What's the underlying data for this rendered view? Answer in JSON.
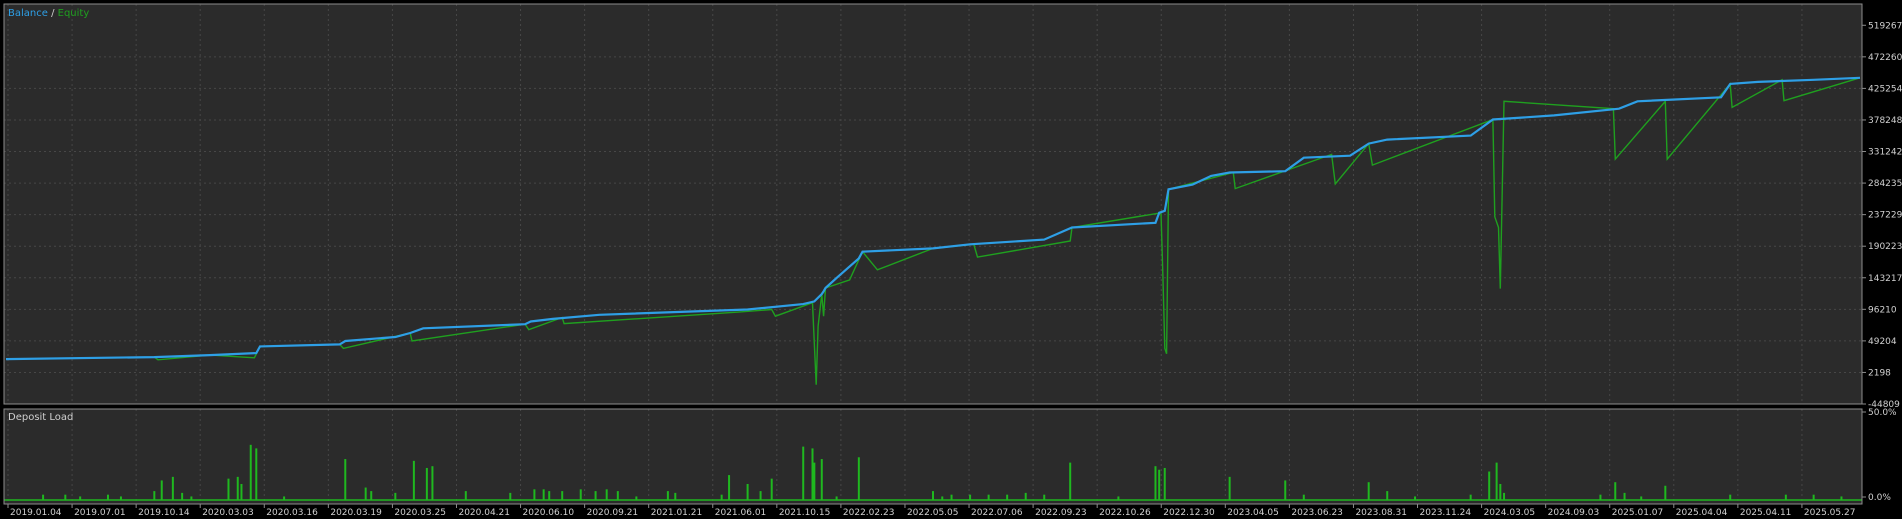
{
  "colors": {
    "background": "#000000",
    "plot_bg": "#2b2b2b",
    "frame": "#8c8c8c",
    "grid": "#474747",
    "balance": "#2e9fe6",
    "equity": "#1fa01f",
    "deposit_load": "#1fb81f",
    "axis_text": "#d0d0d0"
  },
  "main_panel": {
    "legend": {
      "balance": "Balance",
      "separator": " / ",
      "equity": "Equity"
    }
  },
  "sub_panel": {
    "title": "Deposit Load"
  },
  "chart_data": [
    {
      "type": "line",
      "title": "",
      "legend_location": "top-left",
      "grid": true,
      "ylim": [
        -44809,
        545000
      ],
      "y_ticks": [
        519267,
        472260,
        425254,
        378248,
        331242,
        284235,
        237229,
        190223,
        143217,
        96210,
        49204,
        2198,
        -44809
      ],
      "x_tick_labels": [
        "2019.01.04",
        "2019.07.01",
        "2019.10.14",
        "2020.03.03",
        "2020.03.16",
        "2020.03.19",
        "2020.03.25",
        "2020.04.21",
        "2020.06.10",
        "2020.09.21",
        "2021.01.21",
        "2021.06.01",
        "2021.10.15",
        "2022.02.23",
        "2022.05.05",
        "2022.07.06",
        "2022.09.23",
        "2022.10.26",
        "2022.12.30",
        "2023.04.05",
        "2023.06.23",
        "2023.08.31",
        "2023.11.24",
        "2024.03.05",
        "2024.09.03",
        "2025.01.07",
        "2025.04.04",
        "2025.04.11",
        "2025.05.27"
      ],
      "x_domain": [
        0,
        1000
      ],
      "series": [
        {
          "name": "Balance",
          "points": [
            [
              0,
              22000
            ],
            [
              80,
              25000
            ],
            [
              110,
              28000
            ],
            [
              135,
              31000
            ],
            [
              137,
              41000
            ],
            [
              180,
              44000
            ],
            [
              183,
              49000
            ],
            [
              210,
              55000
            ],
            [
              218,
              61000
            ],
            [
              225,
              68000
            ],
            [
              280,
              74000
            ],
            [
              283,
              78000
            ],
            [
              295,
              82000
            ],
            [
              320,
              88000
            ],
            [
              400,
              96000
            ],
            [
              430,
              104000
            ],
            [
              436,
              108000
            ],
            [
              440,
              119000
            ],
            [
              441,
              123000
            ],
            [
              442,
              128000
            ],
            [
              448,
              143000
            ],
            [
              460,
              172000
            ],
            [
              462,
              182000
            ],
            [
              500,
              187000
            ],
            [
              520,
              193000
            ],
            [
              560,
              200000
            ],
            [
              575,
              218000
            ],
            [
              620,
              225000
            ],
            [
              622,
              240000
            ],
            [
              625,
              243000
            ],
            [
              627,
              275000
            ],
            [
              640,
              282000
            ],
            [
              650,
              295000
            ],
            [
              660,
              300000
            ],
            [
              690,
              302000
            ],
            [
              700,
              322000
            ],
            [
              725,
              325000
            ],
            [
              735,
              343000
            ],
            [
              745,
              349000
            ],
            [
              790,
              355000
            ],
            [
              802,
              379000
            ],
            [
              835,
              385000
            ],
            [
              870,
              395000
            ],
            [
              880,
              406000
            ],
            [
              925,
              412000
            ],
            [
              930,
              432000
            ],
            [
              945,
              435000
            ],
            [
              975,
              438000
            ],
            [
              1000,
              441000
            ]
          ]
        },
        {
          "name": "Equity",
          "points": [
            [
              0,
              22000
            ],
            [
              80,
              25000
            ],
            [
              82,
              21000
            ],
            [
              110,
              28000
            ],
            [
              134,
              24000
            ],
            [
              137,
              41000
            ],
            [
              180,
              44000
            ],
            [
              182,
              38000
            ],
            [
              218,
              61000
            ],
            [
              219,
              49000
            ],
            [
              280,
              74000
            ],
            [
              282,
              66000
            ],
            [
              300,
              84000
            ],
            [
              301,
              75000
            ],
            [
              395,
              92000
            ],
            [
              413,
              96000
            ],
            [
              415,
              86000
            ],
            [
              435,
              106000
            ],
            [
              436,
              46000
            ],
            [
              437,
              -16000
            ],
            [
              438,
              71000
            ],
            [
              440,
              119000
            ],
            [
              441,
              86000
            ],
            [
              442,
              128000
            ],
            [
              455,
              140000
            ],
            [
              462,
              182000
            ],
            [
              470,
              155000
            ],
            [
              500,
              187000
            ],
            [
              522,
              193000
            ],
            [
              524,
              174000
            ],
            [
              574,
              198000
            ],
            [
              575,
              218000
            ],
            [
              623,
              240000
            ],
            [
              624,
              146000
            ],
            [
              625,
              38000
            ],
            [
              626,
              30000
            ],
            [
              627,
              275000
            ],
            [
              662,
              300000
            ],
            [
              663,
              276000
            ],
            [
              715,
              327000
            ],
            [
              717,
              283000
            ],
            [
              735,
              343000
            ],
            [
              737,
              311000
            ],
            [
              802,
              379000
            ],
            [
              803,
              234000
            ],
            [
              805,
              218000
            ],
            [
              806,
              127000
            ],
            [
              808,
              406000
            ],
            [
              867,
              395000
            ],
            [
              868,
              320000
            ],
            [
              895,
              406000
            ],
            [
              896,
              320000
            ],
            [
              930,
              432000
            ],
            [
              931,
              397000
            ],
            [
              958,
              438000
            ],
            [
              959,
              407000
            ],
            [
              1000,
              441000
            ]
          ]
        }
      ]
    },
    {
      "type": "bar",
      "title": "Deposit Load",
      "ylim": [
        0,
        50
      ],
      "y_ticks": [
        "50.0%",
        "0.0%"
      ],
      "values_percent": [
        [
          20,
          3
        ],
        [
          32,
          3
        ],
        [
          40,
          2
        ],
        [
          55,
          3
        ],
        [
          62,
          2
        ],
        [
          80,
          5
        ],
        [
          84,
          11
        ],
        [
          90,
          13
        ],
        [
          95,
          4
        ],
        [
          100,
          2
        ],
        [
          120,
          12
        ],
        [
          125,
          13
        ],
        [
          127,
          9
        ],
        [
          132,
          31
        ],
        [
          135,
          29
        ],
        [
          150,
          2
        ],
        [
          183,
          23
        ],
        [
          194,
          7
        ],
        [
          197,
          5
        ],
        [
          210,
          4
        ],
        [
          220,
          22
        ],
        [
          227,
          18
        ],
        [
          230,
          19
        ],
        [
          248,
          5
        ],
        [
          272,
          4
        ],
        [
          285,
          6
        ],
        [
          290,
          6
        ],
        [
          293,
          5
        ],
        [
          300,
          5
        ],
        [
          310,
          6
        ],
        [
          318,
          5
        ],
        [
          324,
          6
        ],
        [
          330,
          5
        ],
        [
          340,
          2
        ],
        [
          357,
          5
        ],
        [
          361,
          4
        ],
        [
          386,
          3
        ],
        [
          390,
          14
        ],
        [
          400,
          9
        ],
        [
          407,
          5
        ],
        [
          413,
          12
        ],
        [
          430,
          30
        ],
        [
          435,
          29
        ],
        [
          436,
          21
        ],
        [
          440,
          23
        ],
        [
          448,
          2
        ],
        [
          460,
          24
        ],
        [
          500,
          5
        ],
        [
          505,
          2
        ],
        [
          510,
          3
        ],
        [
          520,
          3
        ],
        [
          530,
          3
        ],
        [
          540,
          3
        ],
        [
          550,
          4
        ],
        [
          560,
          3
        ],
        [
          574,
          21
        ],
        [
          600,
          2
        ],
        [
          620,
          19
        ],
        [
          622,
          17
        ],
        [
          625,
          18
        ],
        [
          660,
          13
        ],
        [
          690,
          11
        ],
        [
          700,
          3
        ],
        [
          735,
          10
        ],
        [
          745,
          5
        ],
        [
          760,
          2
        ],
        [
          790,
          3
        ],
        [
          800,
          16
        ],
        [
          804,
          21
        ],
        [
          806,
          9
        ],
        [
          808,
          4
        ],
        [
          860,
          3
        ],
        [
          868,
          10
        ],
        [
          873,
          4
        ],
        [
          882,
          2
        ],
        [
          895,
          8
        ],
        [
          930,
          3
        ],
        [
          960,
          3
        ],
        [
          975,
          3
        ],
        [
          990,
          2
        ]
      ]
    }
  ]
}
